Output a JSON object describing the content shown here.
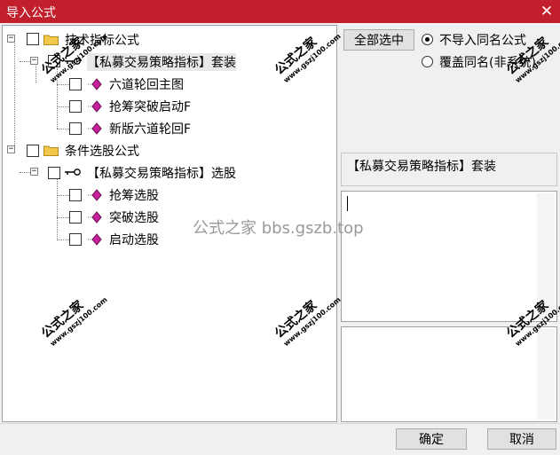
{
  "window": {
    "title": "导入公式",
    "close_glyph": "✕"
  },
  "tree": {
    "group_tech": "技术指标公式",
    "suite_tech": "【私募交易策略指标】套装",
    "item_1": "六道轮回主图",
    "item_2": "抢筹突破启动F",
    "item_3": "新版六道轮回F",
    "group_select": "条件选股公式",
    "suite_select": "【私募交易策略指标】选股",
    "item_4": "抢筹选股",
    "item_5": "突破选股",
    "item_6": "启动选股"
  },
  "options": {
    "select_all": "全部选中",
    "radio_skip": "不导入同名公式",
    "radio_overwrite": "覆盖同名(非系统)",
    "radio_skip_selected": true
  },
  "info": {
    "selected_name": "【私募交易策略指标】套装"
  },
  "footer": {
    "ok": "确定",
    "cancel": "取消"
  },
  "watermark": {
    "main": "公式之家",
    "sub": "www.gszj100.com",
    "center": "公式之家 bbs.gszb.top"
  },
  "icons": {
    "folder": "folder-icon",
    "suite": "key-icon",
    "formula": "formula-diamond-icon",
    "expander": "tree-expander-icon",
    "close": "close-icon"
  },
  "colors": {
    "titlebar": "#c21f2c",
    "folder": "#f2c84b",
    "diamond": "#c8209a"
  }
}
